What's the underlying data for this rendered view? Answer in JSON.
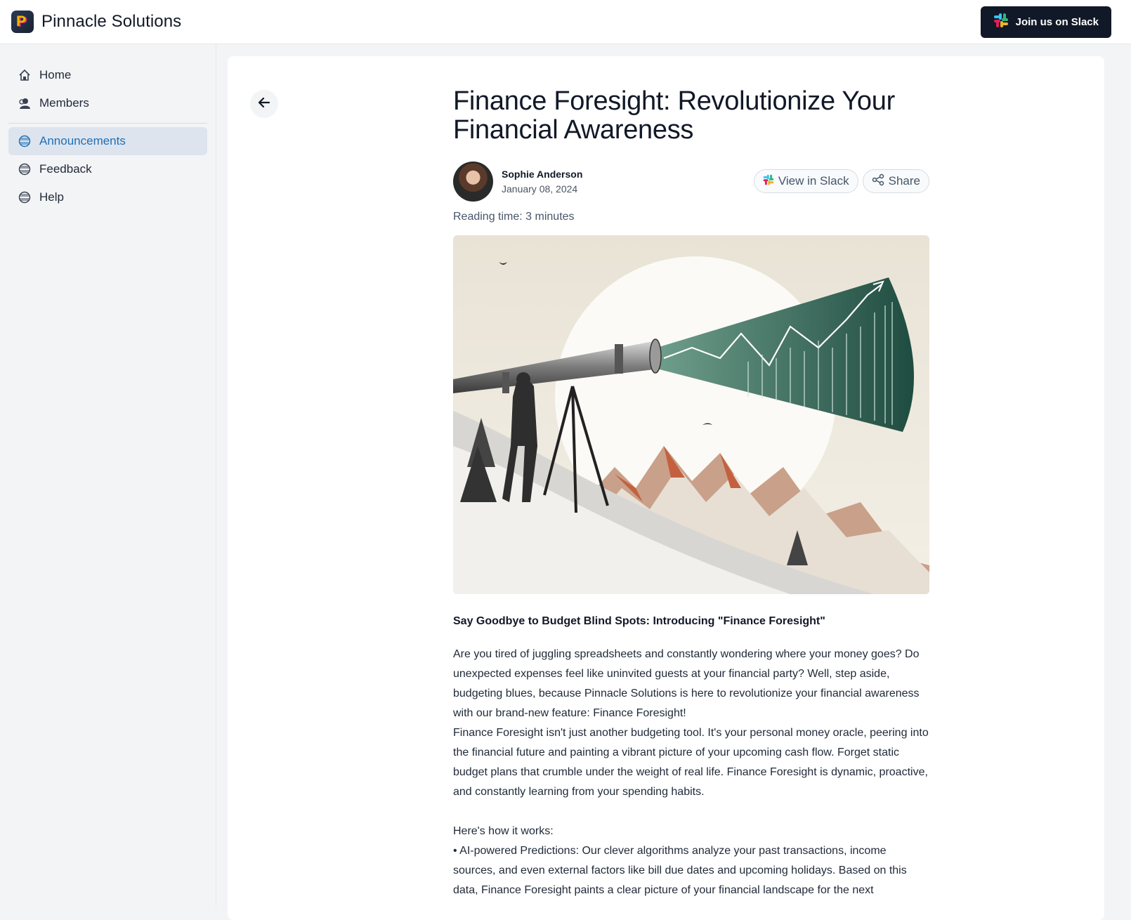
{
  "header": {
    "app_name": "Pinnacle Solutions",
    "logo_letter": "P",
    "slack_button": "Join us on Slack"
  },
  "sidebar": {
    "items": [
      {
        "label": "Home",
        "icon": "home-icon"
      },
      {
        "label": "Members",
        "icon": "members-icon"
      },
      {
        "label": "Announcements",
        "icon": "globe-icon",
        "active": true
      },
      {
        "label": "Feedback",
        "icon": "globe-icon"
      },
      {
        "label": "Help",
        "icon": "globe-icon"
      }
    ]
  },
  "article": {
    "title": "Finance Foresight: Revolutionize Your Financial Awareness",
    "author": "Sophie Anderson",
    "date": "January 08, 2024",
    "view_in_slack": "View in Slack",
    "share": "Share",
    "reading_time": "Reading time: 3 minutes",
    "subtitle": "Say Goodbye to Budget Blind Spots: Introducing \"Finance Foresight\"",
    "paragraphs": [
      "Are you tired of juggling spreadsheets and constantly wondering where your money goes? Do unexpected expenses feel like uninvited guests at your financial party? Well, step aside, budgeting blues, because Pinnacle Solutions is here to revolutionize your financial awareness with our brand-new feature: Finance Foresight!",
      "Finance Foresight isn't just another budgeting tool. It's your personal money oracle, peering into the financial future and painting a vibrant picture of your upcoming cash flow. Forget static budget plans that crumble under the weight of real life. Finance Foresight is dynamic, proactive, and constantly learning from your spending habits."
    ],
    "how_it_works": "Here's how it works:",
    "bullet_1": "• AI-powered Predictions: Our clever algorithms analyze your past transactions, income sources, and even external factors like bill due dates and upcoming holidays. Based on this data, Finance Foresight paints a clear picture of your financial landscape for the next"
  },
  "colors": {
    "accent": "#1f6fb5",
    "active_bg": "#dde4ee",
    "button_dark": "#111827"
  }
}
